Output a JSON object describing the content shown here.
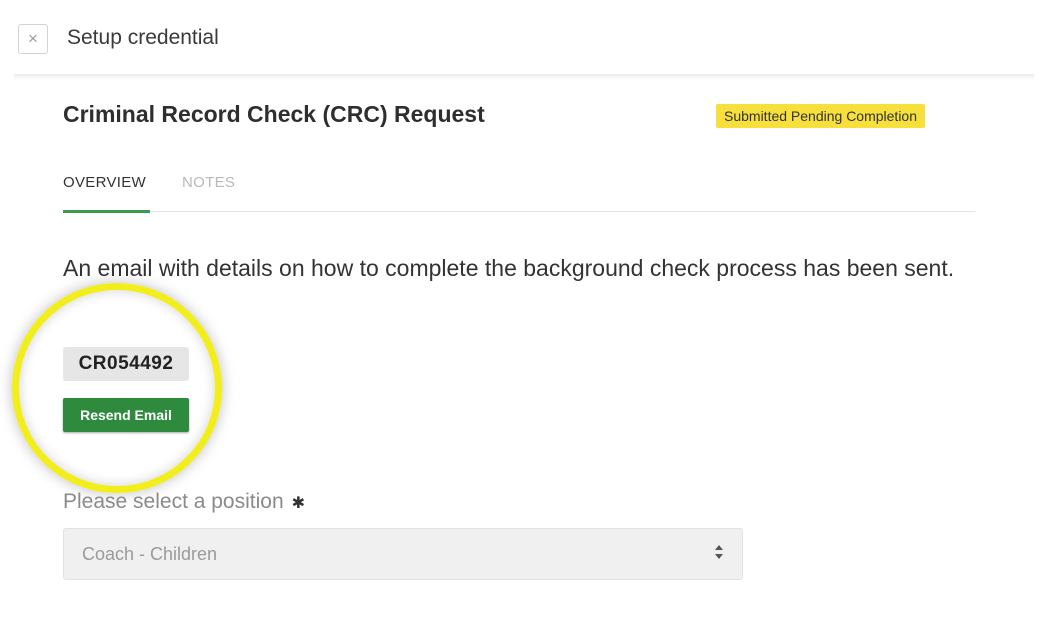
{
  "header": {
    "close_icon": "close-icon",
    "close_glyph": "×",
    "title": "Setup credential"
  },
  "page": {
    "title": "Criminal Record Check (CRC) Request",
    "status": "Submitted Pending Completion",
    "status_color": "#f7df3c"
  },
  "tabs": [
    {
      "label": "OVERVIEW",
      "active": true
    },
    {
      "label": "NOTES",
      "active": false
    }
  ],
  "overview": {
    "message": "An email with details on how to complete the background check process has been sent.",
    "reference_id": "CR054492",
    "resend_label": "Resend Email",
    "resend_color": "#2e8b3e",
    "highlight_color": "#f2ee1b"
  },
  "position_field": {
    "label": "Please select a position",
    "required_mark": "✱",
    "selected": "Coach - Children",
    "caret_icon": "select-caret-icon"
  },
  "accent_color": "#3c9a53"
}
